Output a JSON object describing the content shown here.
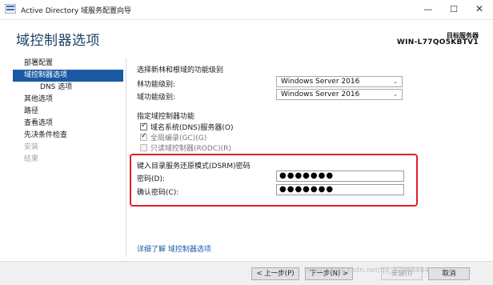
{
  "window": {
    "title": "Active Directory 域服务配置向导",
    "min_glyph": "—",
    "max_glyph": "☐",
    "close_glyph": "✕"
  },
  "header": {
    "title": "域控制器选项",
    "target_label": "目标服务器",
    "target_name": "WIN-L77QO5KBTV1"
  },
  "sidebar": {
    "items": [
      {
        "label": "部署配置"
      },
      {
        "label": "域控制器选项"
      },
      {
        "label": "DNS 选项"
      },
      {
        "label": "其他选项"
      },
      {
        "label": "路径"
      },
      {
        "label": "查看选项"
      },
      {
        "label": "先决条件检查"
      },
      {
        "label": "安装"
      },
      {
        "label": "结果"
      }
    ]
  },
  "functional_level": {
    "heading": "选择新林和根域的功能级别",
    "forest_label": "林功能级别:",
    "forest_value": "Windows Server 2016",
    "domain_label": "域功能级别:",
    "domain_value": "Windows Server 2016"
  },
  "capabilities": {
    "heading": "指定域控制器功能",
    "items": [
      {
        "label": "域名系统(DNS)服务器(O)",
        "checked": true
      },
      {
        "label": "全局编录(GC)(G)",
        "checked": true
      },
      {
        "label": "只读域控制器(RODC)(R)",
        "checked": false
      }
    ]
  },
  "dsrm": {
    "heading": "键入目录服务还原模式(DSRM)密码",
    "password_label": "密码(D):",
    "password_value": "●●●●●●●",
    "confirm_label": "确认密码(C):",
    "confirm_value": "●●●●●●●"
  },
  "more_link": "详细了解 域控制器选项",
  "footer": {
    "back": "< 上一步(P)",
    "next": "下一步(N) >",
    "install": "安装(I)",
    "cancel": "取消"
  },
  "watermark": "https://blog.csdn.net/qq_57988484",
  "colors": {
    "accent": "#1b5aa3",
    "highlight_box": "#e0202b",
    "link": "#1a5aa8"
  }
}
